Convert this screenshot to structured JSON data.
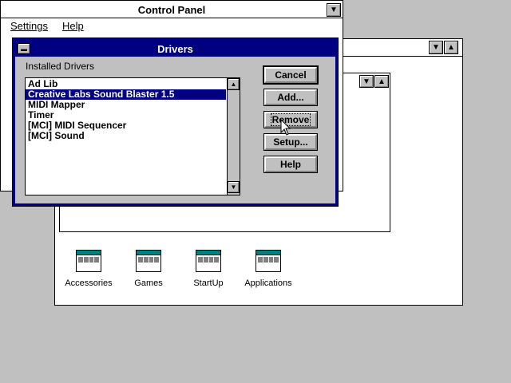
{
  "control_panel": {
    "title": "Control Panel",
    "menu": [
      "Settings",
      "Help"
    ]
  },
  "program_manager": {
    "groups": [
      {
        "label": "Accessories"
      },
      {
        "label": "Games"
      },
      {
        "label": "StartUp"
      },
      {
        "label": "Applications"
      }
    ]
  },
  "drivers_dialog": {
    "title": "Drivers",
    "installed_label": "Installed Drivers",
    "drivers": [
      "Ad Lib",
      "Creative Labs Sound Blaster 1.5",
      "MIDI Mapper",
      "Timer",
      "[MCI] MIDI Sequencer",
      "[MCI] Sound"
    ],
    "selected_index": 1,
    "buttons": {
      "cancel": "Cancel",
      "add": "Add...",
      "remove": "Remove",
      "setup": "Setup...",
      "help": "Help"
    }
  },
  "colors": {
    "selection": "#000080",
    "dialog_title": "#000080",
    "desktop": "#c0c0c0"
  }
}
